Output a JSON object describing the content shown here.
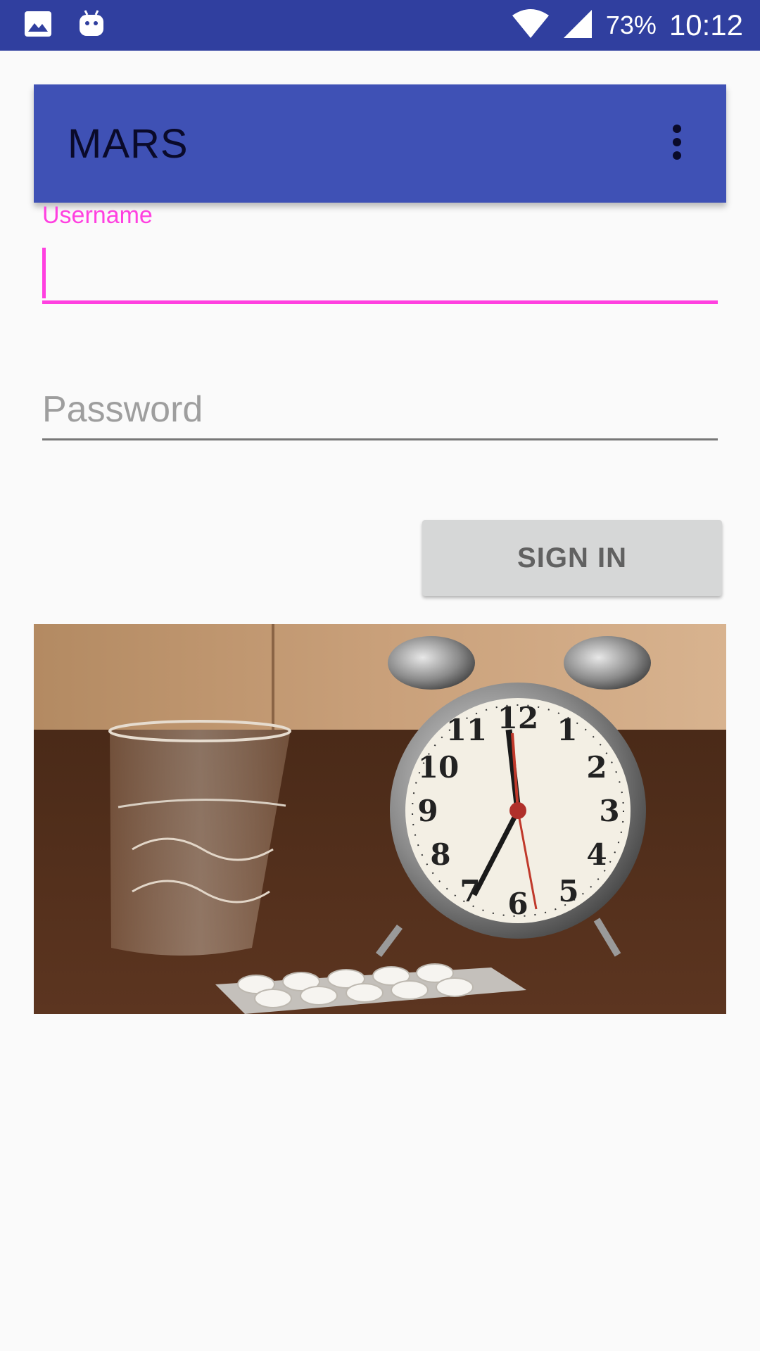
{
  "status_bar": {
    "battery": "73%",
    "time": "10:12",
    "icons": [
      "gallery-icon",
      "android-icon",
      "wifi-icon",
      "cell-signal-icon"
    ]
  },
  "app_bar": {
    "title": "MARS",
    "menu_icon": "more-vert-icon"
  },
  "form": {
    "username": {
      "label": "Username",
      "value": ""
    },
    "password": {
      "placeholder": "Password",
      "value": ""
    },
    "sign_in_label": "SIGN IN"
  },
  "image": {
    "icon": "alarm-clock-photo"
  },
  "colors": {
    "status_bar": "#303f9f",
    "primary": "#3f51b5",
    "accent": "#ff40e0",
    "button_bg": "#d6d7d7"
  }
}
